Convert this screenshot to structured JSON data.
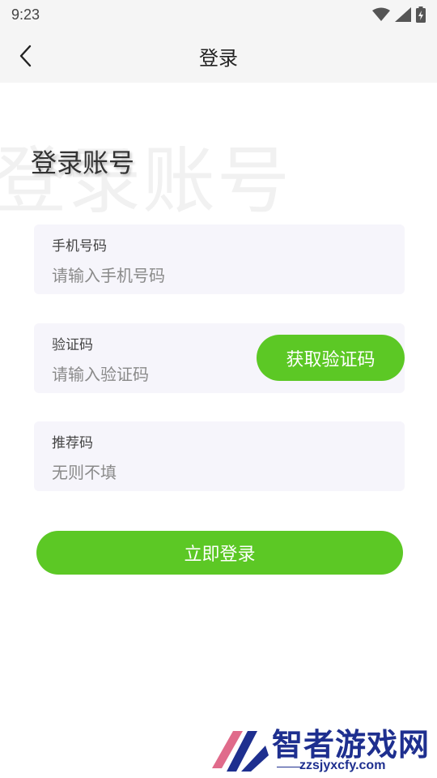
{
  "status_bar": {
    "time": "9:23",
    "icons": [
      "wifi-icon",
      "signal-icon",
      "battery-charging-icon"
    ]
  },
  "app_bar": {
    "back_icon": "chevron-left-icon",
    "title": "登录"
  },
  "content": {
    "background_title": "登录账号",
    "section_title": "登录账号"
  },
  "form": {
    "phone": {
      "label": "手机号码",
      "placeholder": "请输入手机号码",
      "value": ""
    },
    "code": {
      "label": "验证码",
      "placeholder": "请输入验证码",
      "value": "",
      "button_label": "获取验证码"
    },
    "referral": {
      "label": "推荐码",
      "placeholder": "无则不填",
      "value": ""
    },
    "submit_label": "立即登录"
  },
  "colors": {
    "accent": "#5cc825",
    "field_bg": "#f6f5fb",
    "bar_bg": "#f5f5f5"
  },
  "watermark": {
    "name": "智者游戏网",
    "domain": "zzsjyxcfy.com"
  }
}
